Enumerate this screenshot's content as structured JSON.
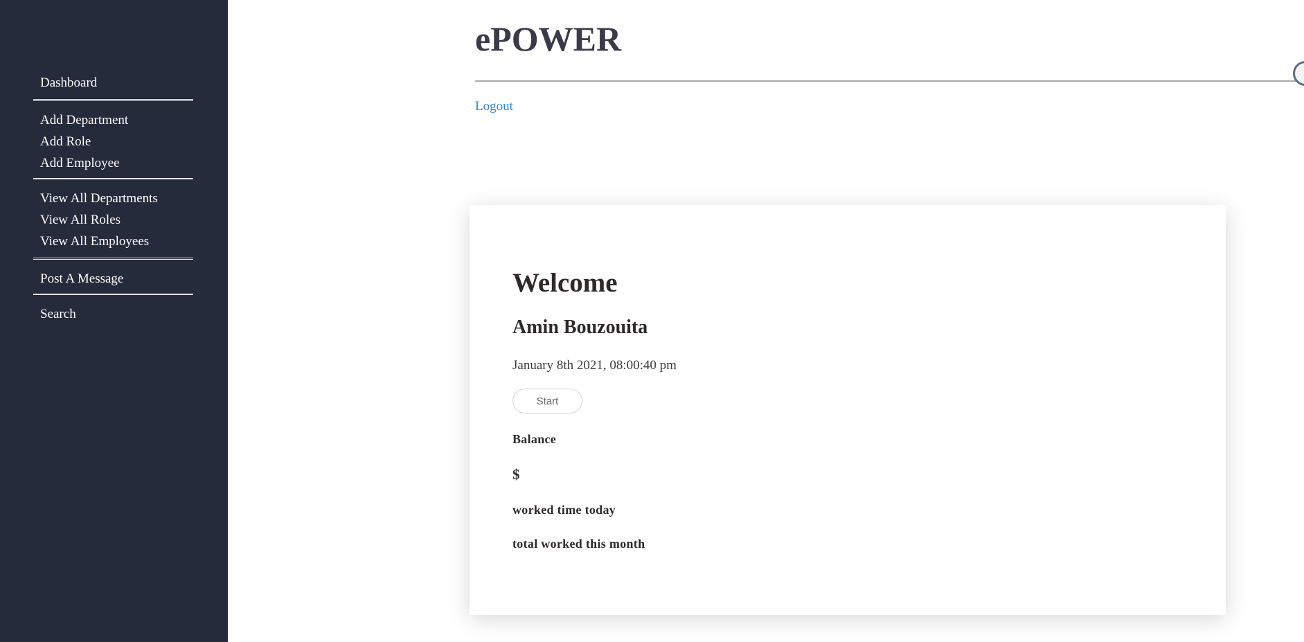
{
  "sidebar": {
    "items": [
      {
        "label": "Dashboard"
      },
      {
        "label": "Add Department"
      },
      {
        "label": "Add Role"
      },
      {
        "label": "Add Employee"
      },
      {
        "label": "View All Departments"
      },
      {
        "label": "View All Roles"
      },
      {
        "label": "View All Employees"
      },
      {
        "label": "Post A Message"
      },
      {
        "label": "Search"
      }
    ]
  },
  "header": {
    "brand": "ePOWER",
    "logout_label": "Logout"
  },
  "card": {
    "welcome": "Welcome",
    "user_name": "Amin Bouzouita",
    "datetime": "January 8th 2021, 08:00:40 pm",
    "start_label": "Start",
    "balance_label": "Balance",
    "currency_symbol": "$",
    "worked_today_label": "worked time today",
    "worked_month_label": "total worked this month"
  },
  "colors": {
    "sidebar_bg": "#252b3b",
    "link": "#2f8ae2",
    "text_dark": "#2e2a2a"
  }
}
